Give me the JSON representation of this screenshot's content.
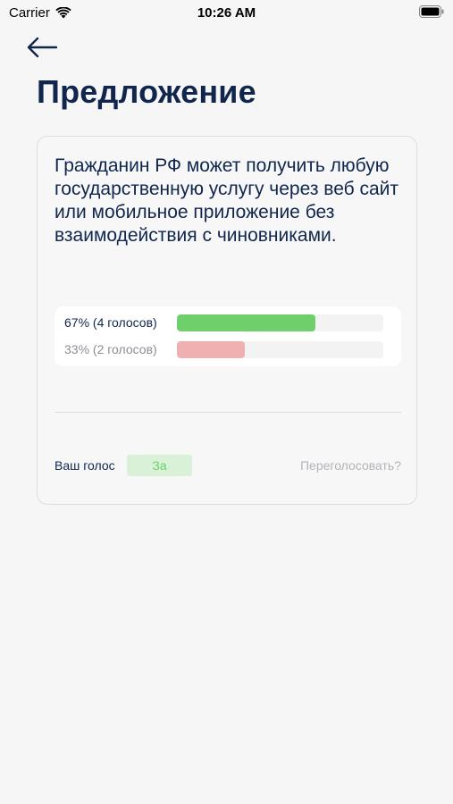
{
  "status_bar": {
    "carrier": "Carrier",
    "time": "10:26 AM"
  },
  "header": {
    "title": "Предложение"
  },
  "proposal": {
    "text": "Гражданин РФ может получить любую государственную услугу через веб сайт или мобильное приложение без взаимодействия с чиновниками.",
    "results": [
      {
        "label": "67% (4 голосов)",
        "percent": 67,
        "color": "#6dd06a"
      },
      {
        "label": "33% (2 голосов)",
        "percent": 33,
        "color": "#eeb0b1"
      }
    ]
  },
  "vote": {
    "label": "Ваш голос",
    "value": "За",
    "revote": "Переголосовать?"
  },
  "colors": {
    "primary": "#10264c",
    "for": "#6dd06a",
    "against": "#eeb0b1",
    "background": "#f6f6f7"
  },
  "icons": [
    "wifi-icon",
    "battery-icon",
    "back-arrow-icon"
  ]
}
